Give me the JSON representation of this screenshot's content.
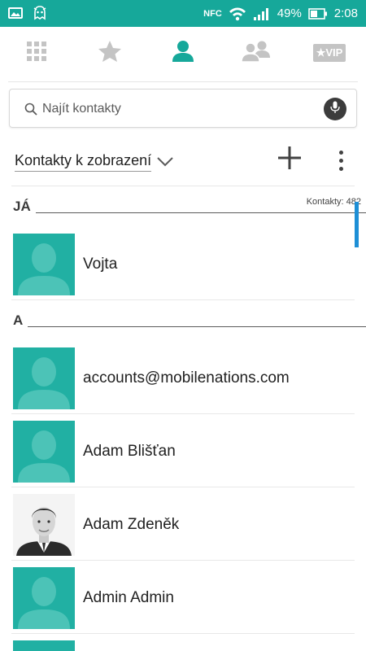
{
  "status_bar": {
    "battery_percent": "49%",
    "time": "2:08",
    "nfc_text": "NFC",
    "background_color": "#16a89a",
    "icons": [
      "gallery-icon",
      "ghost-icon",
      "nfc-icon",
      "wifi-icon",
      "signal-icon",
      "battery-icon"
    ]
  },
  "tabs": [
    {
      "icon": "grid-icon",
      "active": false
    },
    {
      "icon": "star-icon",
      "active": false
    },
    {
      "icon": "person-icon",
      "active": true
    },
    {
      "icon": "group-icon",
      "active": false
    },
    {
      "icon": "vip-icon",
      "label": "★VIP",
      "active": false
    }
  ],
  "accent_color": "#16a89a",
  "search": {
    "placeholder": "Najít kontakty"
  },
  "filter": {
    "label": "Kontakty k zobrazení"
  },
  "sections": [
    {
      "letter": "JÁ",
      "count": "Kontakty: 482"
    },
    {
      "letter": "A"
    }
  ],
  "contacts": [
    {
      "name": "Vojta",
      "avatar": "placeholder"
    },
    {
      "name": "accounts@mobilenations.com",
      "avatar": "placeholder"
    },
    {
      "name": "Adam Blišťan",
      "avatar": "placeholder"
    },
    {
      "name": "Adam Zdeněk",
      "avatar": "photo"
    },
    {
      "name": "Admin Admin",
      "avatar": "placeholder"
    }
  ]
}
